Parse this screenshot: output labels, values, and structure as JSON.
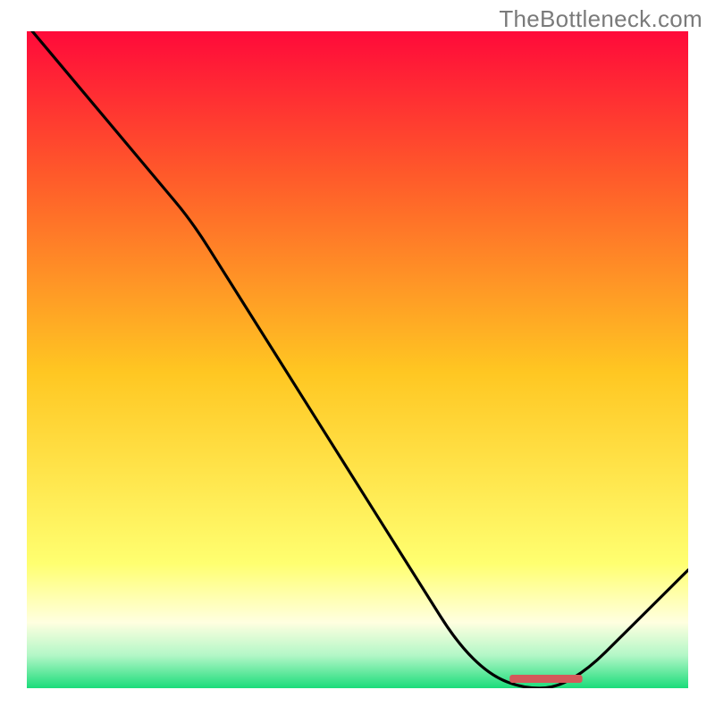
{
  "watermark": "TheBottleneck.com",
  "colors": {
    "gradient_top": "#ff0a3a",
    "gradient_upper": "#ff5a2a",
    "gradient_mid": "#ffc722",
    "gradient_lower_yellow": "#ffff70",
    "gradient_pale": "#ffffe0",
    "gradient_green_light": "#b3f7c7",
    "gradient_green": "#1bdc7a",
    "curve_stroke": "#000000",
    "marker": "#d45a5a"
  },
  "chart_data": {
    "type": "line",
    "title": "",
    "xlabel": "",
    "ylabel": "",
    "xlim": [
      0,
      100
    ],
    "ylim": [
      0,
      100
    ],
    "x": [
      0,
      5,
      10,
      15,
      20,
      25,
      30,
      35,
      40,
      45,
      50,
      55,
      60,
      65,
      70,
      75,
      80,
      85,
      90,
      95,
      100
    ],
    "values": [
      101,
      95,
      89,
      83,
      77,
      71,
      63,
      55,
      47,
      39,
      31,
      23,
      15,
      7,
      2,
      0,
      0,
      3,
      8,
      13,
      18
    ],
    "minimum_band_x": [
      73,
      84
    ],
    "notes": "Curve descends from top-left, reaches 0 near x≈76–82, then rises toward the right. No axis ticks or labels are rendered in the source image; values are visual estimates on a 0–100 scale."
  }
}
